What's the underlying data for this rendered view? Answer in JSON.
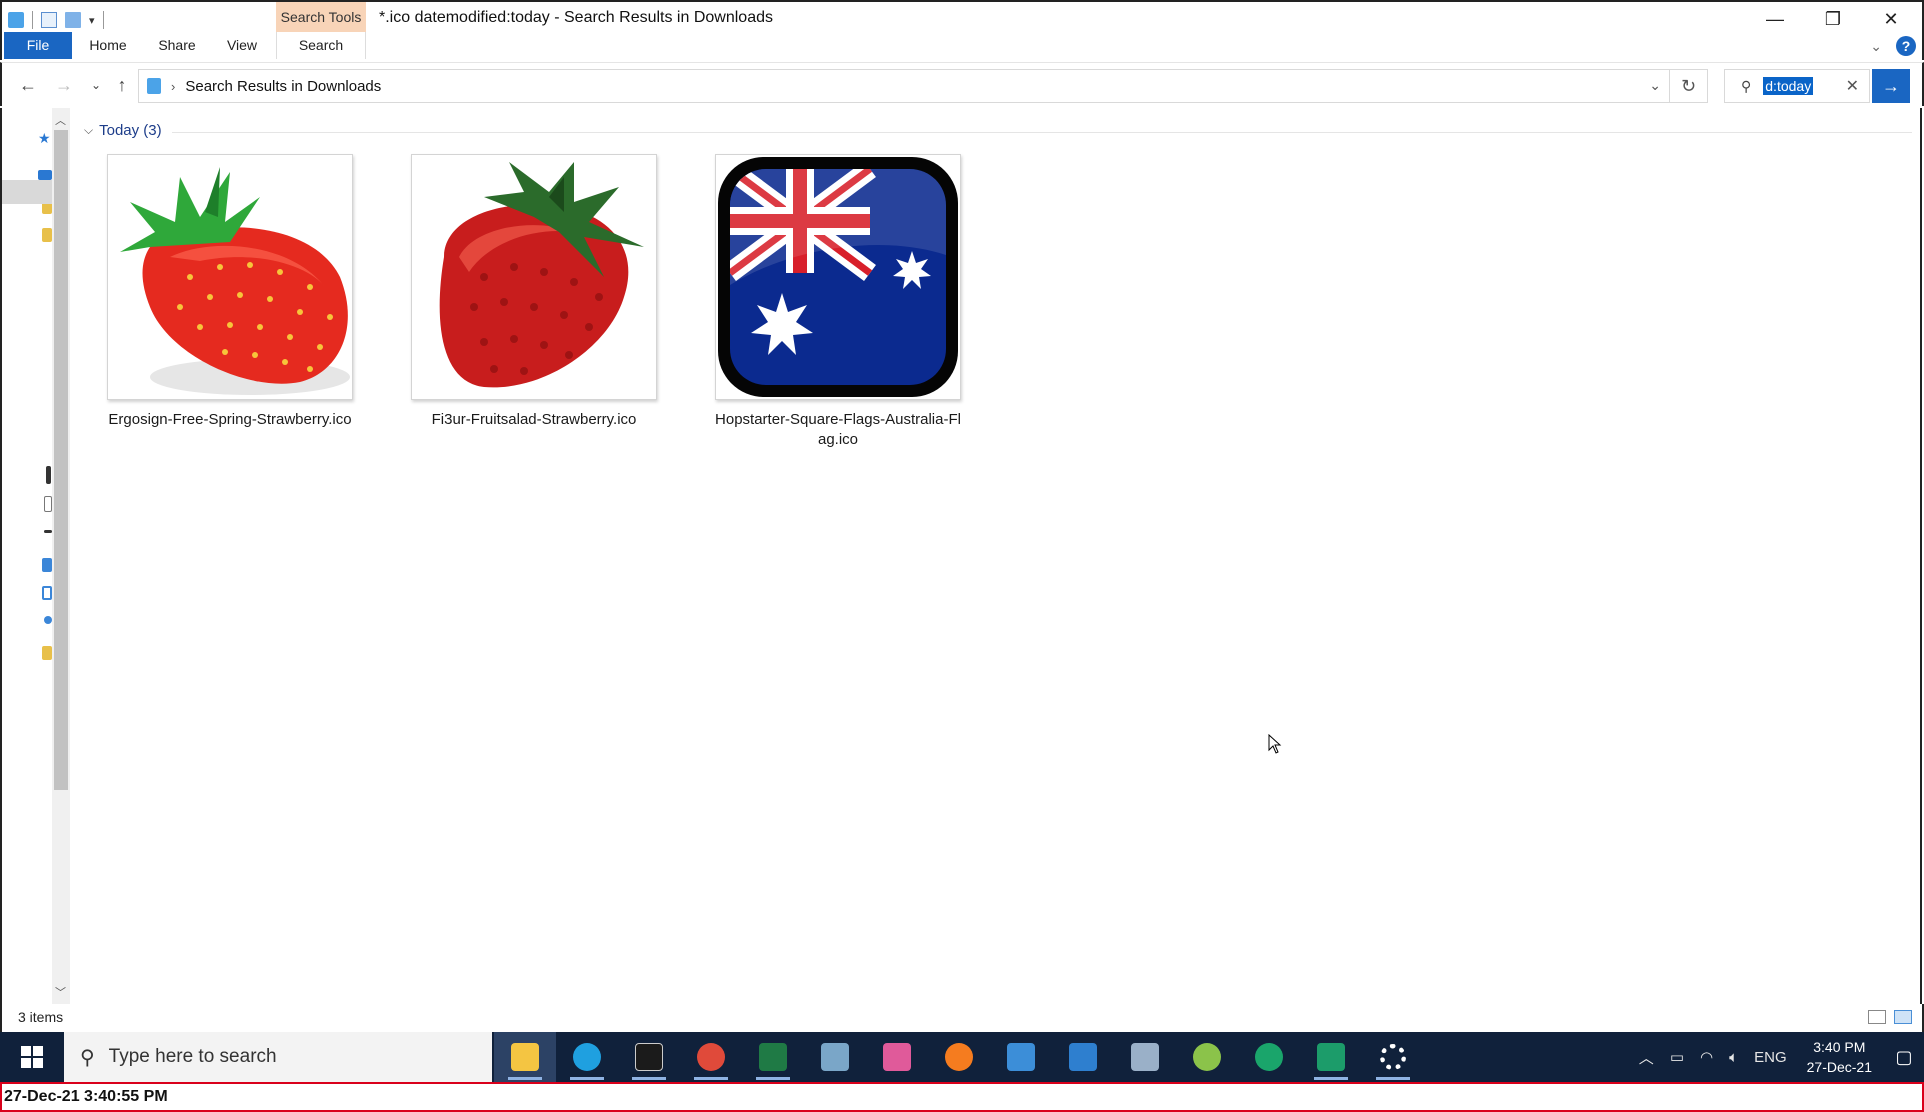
{
  "window": {
    "title": "*.ico datemodified:today - Search Results in Downloads",
    "context_tab": "Search Tools",
    "controls": {
      "minimize": "—",
      "restore": "❐",
      "close": "✕"
    }
  },
  "ribbon": {
    "tabs": [
      "File",
      "Home",
      "Share",
      "View",
      "Search"
    ]
  },
  "address": {
    "breadcrumb": "Search Results in Downloads",
    "search_value": "d:today"
  },
  "group": {
    "label": "Today (3)"
  },
  "files": [
    {
      "name": "Ergosign-Free-Spring-Strawberry.ico",
      "icon": "strawberry-icon"
    },
    {
      "name": "Fi3ur-Fruitsalad-Strawberry.ico",
      "icon": "strawberry-icon"
    },
    {
      "name": "Hopstarter-Square-Flags-Australia-Flag.ico",
      "icon": "australia-flag-icon"
    }
  ],
  "status": {
    "item_count": "3 items"
  },
  "taskbar": {
    "search_placeholder": "Type here to search",
    "apps": [
      {
        "name": "file-explorer",
        "color": "#f4c542"
      },
      {
        "name": "edge",
        "color": "#1fa0e0"
      },
      {
        "name": "terminal",
        "color": "#1b1b1b"
      },
      {
        "name": "chrome",
        "color": "#e04a3a"
      },
      {
        "name": "excel",
        "color": "#1f7a45"
      },
      {
        "name": "editor",
        "color": "#7aa6c8"
      },
      {
        "name": "drop-app",
        "color": "#e05a9a"
      },
      {
        "name": "firefox",
        "color": "#f57c1f"
      },
      {
        "name": "contacts",
        "color": "#3c8ed8"
      },
      {
        "name": "photos",
        "color": "#2e7fcf"
      },
      {
        "name": "paint",
        "color": "#9ab0c8"
      },
      {
        "name": "android-app",
        "color": "#8bc34a"
      },
      {
        "name": "green-app",
        "color": "#1aa56b"
      },
      {
        "name": "shield-app",
        "color": "#1c9c6a"
      },
      {
        "name": "settings",
        "color": "#ffffff"
      }
    ],
    "language": "ENG",
    "time": "3:40 PM",
    "date": "27-Dec-21"
  },
  "timestamp": "27-Dec-21 3:40:55 PM"
}
